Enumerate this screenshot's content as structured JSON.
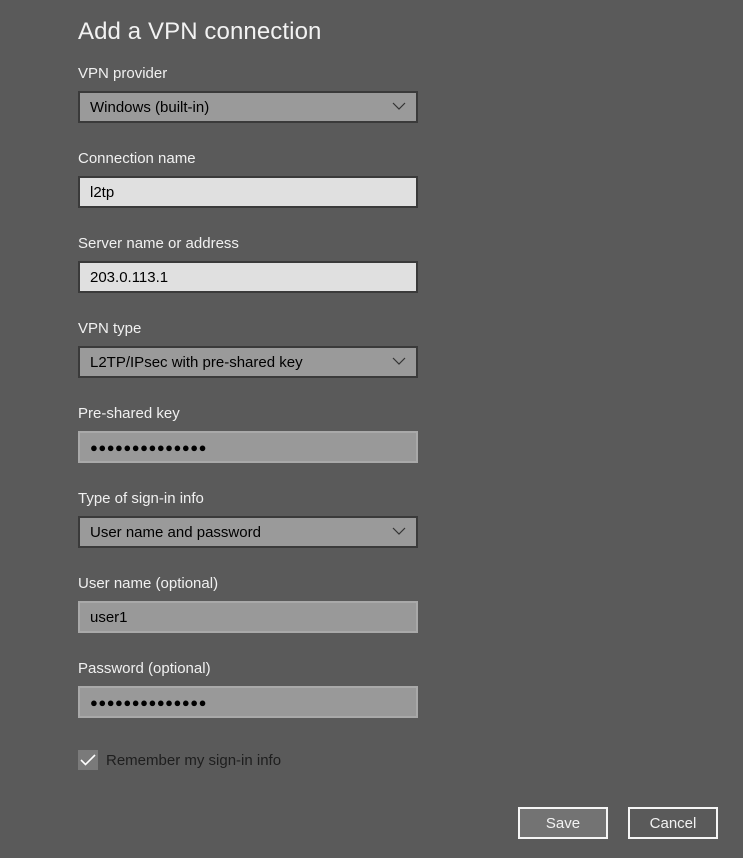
{
  "dialog": {
    "title": "Add a VPN connection"
  },
  "fields": {
    "vpn_provider": {
      "label": "VPN provider",
      "value": "Windows (built-in)"
    },
    "connection_name": {
      "label": "Connection name",
      "value": "l2tp"
    },
    "server": {
      "label": "Server name or address",
      "value": "203.0.113.1"
    },
    "vpn_type": {
      "label": "VPN type",
      "value": "L2TP/IPsec with pre-shared key"
    },
    "pre_shared_key": {
      "label": "Pre-shared key",
      "masked_value": "●●●●●●●●●●●●●●"
    },
    "sign_in_type": {
      "label": "Type of sign-in info",
      "value": "User name and password"
    },
    "username": {
      "label": "User name (optional)",
      "value": "user1"
    },
    "password": {
      "label": "Password (optional)",
      "masked_value": "●●●●●●●●●●●●●●"
    }
  },
  "remember": {
    "label": "Remember my sign-in info",
    "checked": true
  },
  "buttons": {
    "save": "Save",
    "cancel": "Cancel"
  },
  "icons": {
    "dropdown": "chevron-down-icon",
    "check": "checkmark-icon"
  }
}
